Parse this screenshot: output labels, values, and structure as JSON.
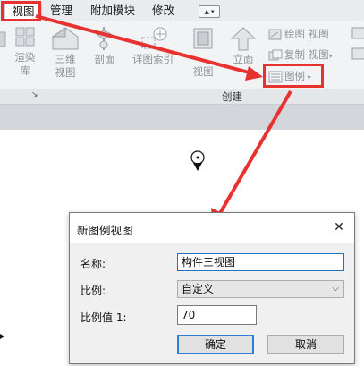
{
  "tabs": {
    "view": "视图",
    "manage": "管理",
    "addins": "附加模块",
    "modify": "修改",
    "dropdown": "▲ ▾"
  },
  "ribbon": {
    "render_library": "渲染\n库",
    "threed_view": "三维\n视图",
    "section": "剖面",
    "detail_index": "详图索引",
    "plan_view": "视图",
    "elevation": "立面",
    "drafting_view": "绘图 视图",
    "duplicate_view": "复制 视图",
    "legend": "图例",
    "panel_label": "创建",
    "panel_launcher": "↘"
  },
  "dialog": {
    "title": "新图例视图",
    "name_label": "名称:",
    "name_value": "构件三视图",
    "scale_label": "比例:",
    "scale_value": "自定义",
    "scale_value_label": "比例值 1:",
    "scale_number": "70",
    "ok": "确定",
    "cancel": "取消"
  },
  "colors": {
    "highlight": "#e8322f",
    "primary_border": "#2f7fd6"
  }
}
